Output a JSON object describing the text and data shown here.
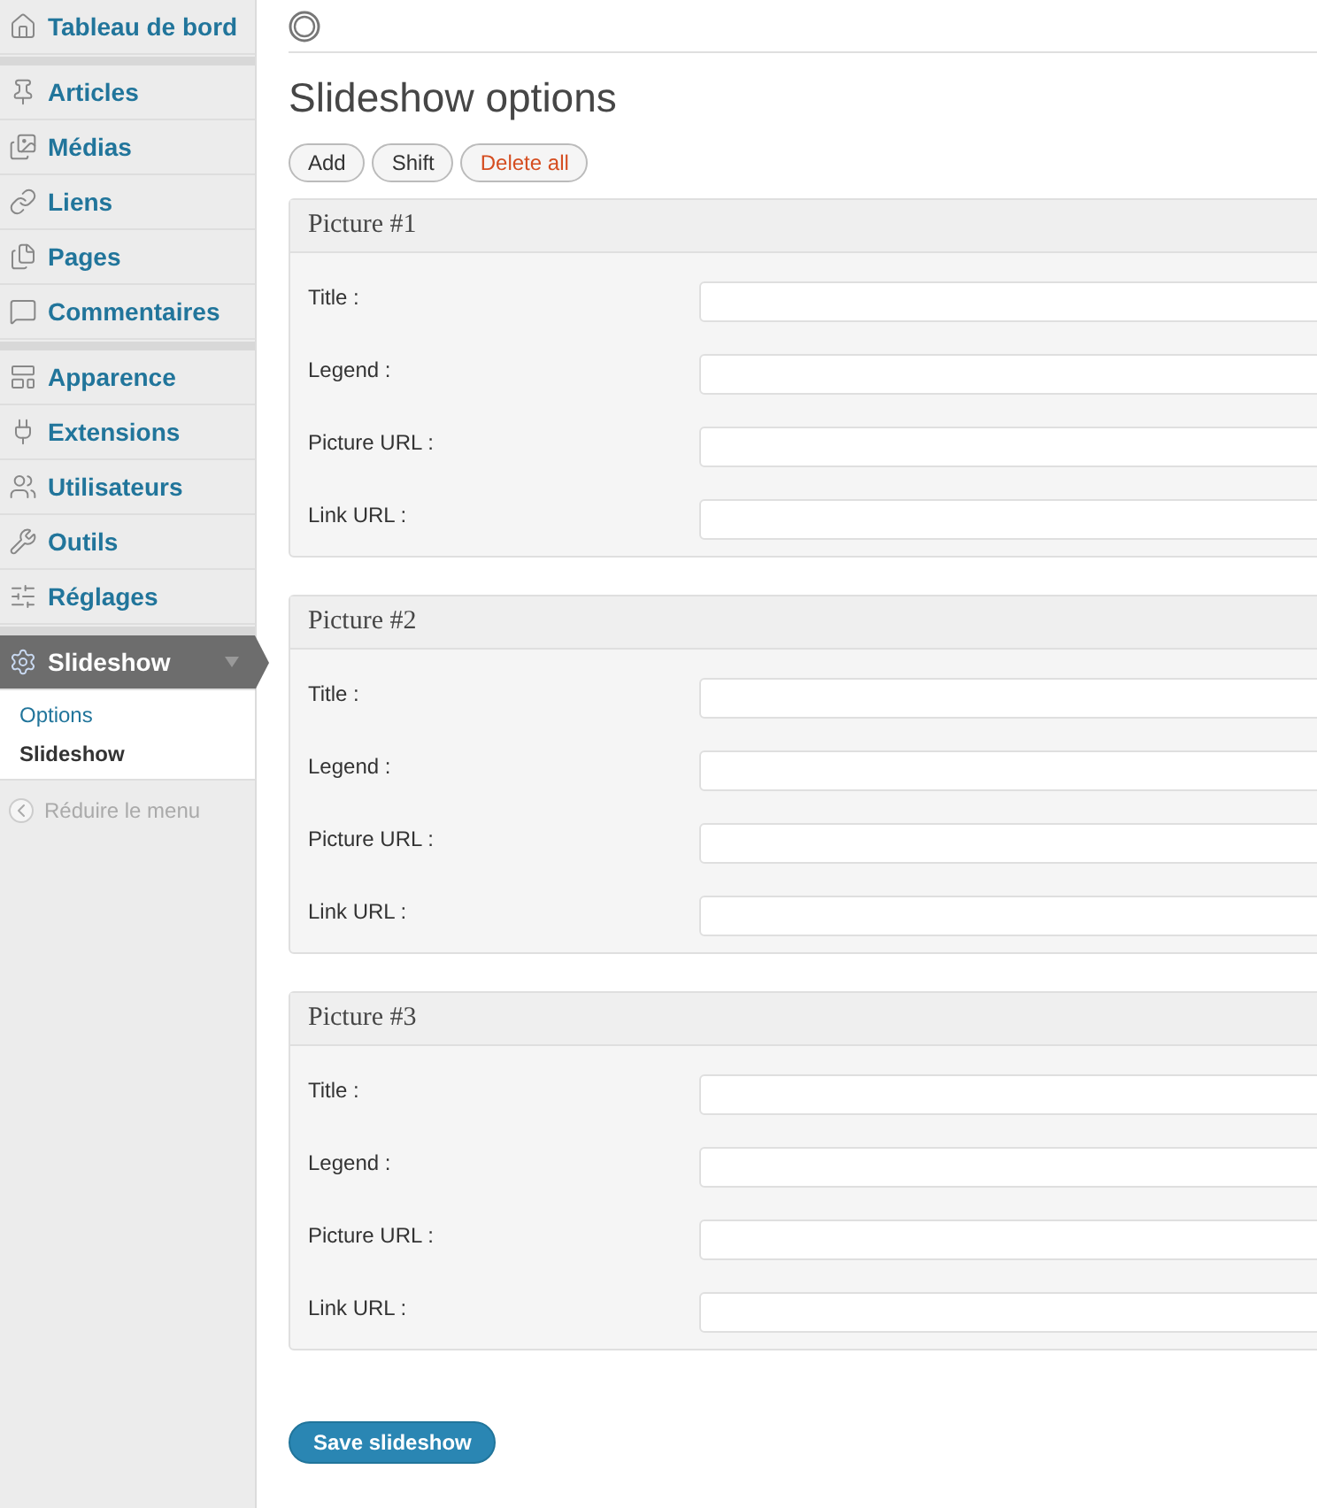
{
  "sidebar": {
    "groups": [
      [
        {
          "label": "Tableau de bord",
          "selected": false
        }
      ],
      [
        {
          "label": "Articles",
          "selected": false
        },
        {
          "label": "Médias",
          "selected": false
        },
        {
          "label": "Liens",
          "selected": false
        },
        {
          "label": "Pages",
          "selected": false
        },
        {
          "label": "Commentaires",
          "selected": false
        }
      ],
      [
        {
          "label": "Apparence",
          "selected": false
        },
        {
          "label": "Extensions",
          "selected": false
        },
        {
          "label": "Utilisateurs",
          "selected": false
        },
        {
          "label": "Outils",
          "selected": false
        },
        {
          "label": "Réglages",
          "selected": false
        }
      ],
      [
        {
          "label": "Slideshow",
          "selected": true,
          "submenu": [
            {
              "label": "Options",
              "selected": false
            },
            {
              "label": "Slideshow",
              "selected": true
            }
          ]
        }
      ]
    ],
    "collapse": "Réduire le menu"
  },
  "page": {
    "title": "Slideshow options",
    "buttons": [
      {
        "label": "Add",
        "kind": "normal"
      },
      {
        "label": "Shift",
        "kind": "normal"
      },
      {
        "label": "Delete all",
        "kind": "danger"
      }
    ],
    "pictures": [
      {
        "title": "Picture #1",
        "fields": [
          "Title :",
          "Legend :",
          "Picture URL :",
          "Link URL :"
        ]
      },
      {
        "title": "Picture #2",
        "fields": [
          "Title :",
          "Legend :",
          "Picture URL :",
          "Link URL :"
        ]
      },
      {
        "title": "Picture #3",
        "fields": [
          "Title :",
          "Legend :",
          "Picture URL :",
          "Link URL :"
        ]
      }
    ],
    "save_button": "Save slideshow"
  }
}
